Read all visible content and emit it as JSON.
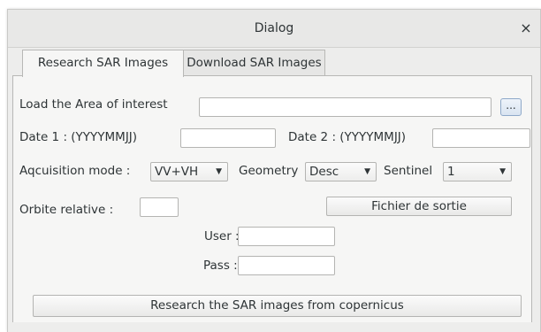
{
  "window": {
    "title": "Dialog",
    "close_glyph": "×"
  },
  "tabs": [
    {
      "label": "Research SAR Images",
      "active": true
    },
    {
      "label": "Download SAR Images",
      "active": false
    }
  ],
  "form": {
    "aoi_label": "Load the Area of interest",
    "aoi_value": "",
    "browse_label": "...",
    "date1_label": "Date 1 : (YYYYMMJJ)",
    "date1_value": "",
    "date2_label": "Date 2 : (YYYYMMJJ)",
    "date2_value": "",
    "acq_label": "Aqcuisition mode :",
    "acq_value": "VV+VH",
    "geometry_label": "Geometry",
    "geometry_value": "Desc",
    "sentinel_label": "Sentinel",
    "sentinel_value": "1",
    "orbit_label": "Orbite relative :",
    "orbit_value": "",
    "output_button": "Fichier de sortie",
    "user_label": "User :",
    "user_value": "",
    "pass_label": "Pass :",
    "pass_value": "",
    "search_button": "Research the SAR images from copernicus"
  },
  "colors": {
    "window_bg": "#ededec",
    "panel_bg": "#f6f6f5",
    "text": "#2e3436",
    "border": "#b4b4b2"
  },
  "icons": {
    "close": "close-icon",
    "dropdown": "chevron-down-icon"
  }
}
